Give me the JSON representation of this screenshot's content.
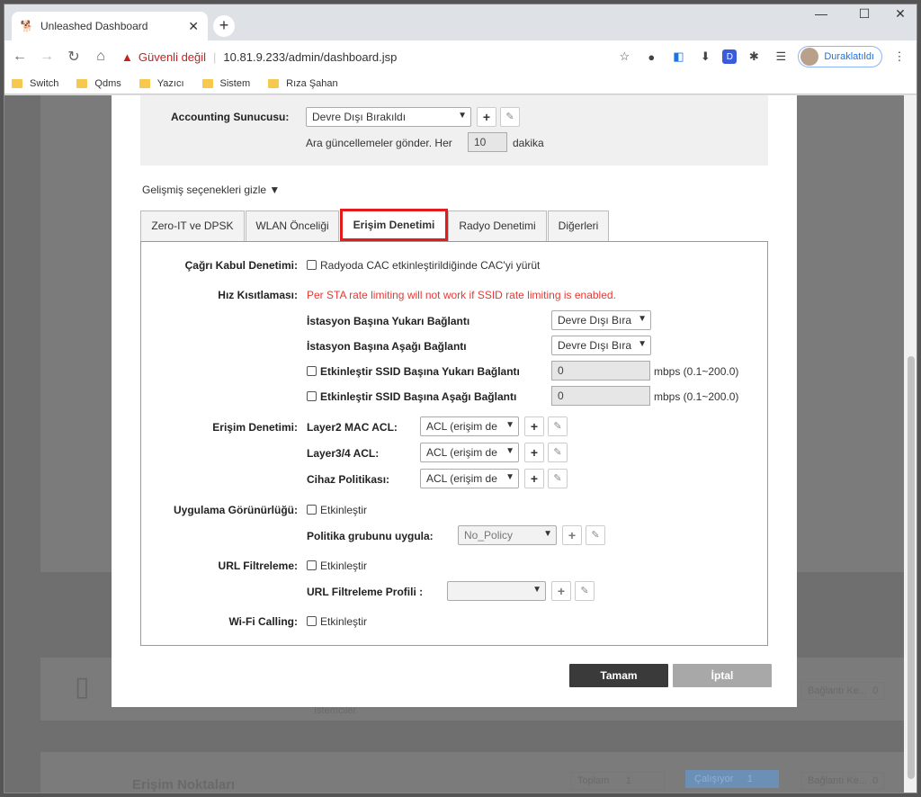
{
  "browser": {
    "tab_title": "Unleashed Dashboard",
    "insecure_label": "Güvenli değil",
    "url": "10.81.9.233/admin/dashboard.jsp",
    "profile_label": "Duraklatıldı",
    "bookmarks": [
      "Switch",
      "Qdms",
      "Yazıcı",
      "Sistem",
      "Rıza Şahan"
    ]
  },
  "background": {
    "clients_label": "İstemciler",
    "access_points_label": "Erişim Noktaları",
    "total_label": "Toplam",
    "total_value": "1",
    "running_label": "Çalışıyor",
    "running_value": "1",
    "disconnected_label": "Bağlantı Ke...",
    "disconnected_value": "0"
  },
  "dialog": {
    "accounting": {
      "label": "Accounting Sunucusu:",
      "value": "Devre Dışı Bırakıldı",
      "interim_prefix": "Ara güncellemeler gönder. Her",
      "interim_value": "10",
      "interim_suffix": "dakika"
    },
    "advanced_toggle": "Gelişmiş seçenekleri gizle ▼",
    "tabs": [
      "Zero-IT ve DPSK",
      "WLAN Önceliği",
      "Erişim Denetimi",
      "Radyo Denetimi",
      "Diğerleri"
    ],
    "active_tab": "Erişim Denetimi",
    "cac": {
      "label": "Çağrı Kabul Denetimi:",
      "checkbox_label": "Radyoda CAC etkinleştirildiğinde CAC'yi yürüt"
    },
    "rate": {
      "label": "Hız Kısıtlaması:",
      "warning": "Per STA rate limiting will not work if SSID rate limiting is enabled.",
      "uplink_label": "İstasyon Başına Yukarı Bağlantı",
      "uplink_value": "Devre Dışı Bıra",
      "downlink_label": "İstasyon Başına Aşağı Bağlantı",
      "downlink_value": "Devre Dışı Bıra",
      "ssid_up_label": "Etkinleştir SSID Başına Yukarı Bağlantı",
      "ssid_up_value": "0",
      "ssid_down_label": "Etkinleştir SSID Başına Aşağı Bağlantı",
      "ssid_down_value": "0",
      "mbps_hint": "mbps (0.1~200.0)"
    },
    "acl": {
      "label": "Erişim Denetimi:",
      "l2_label": "Layer2 MAC ACL:",
      "l2_value": "ACL (erişim de",
      "l34_label": "Layer3/4 ACL:",
      "l34_value": "ACL (erişim de",
      "device_label": "Cihaz Politikası:",
      "device_value": "ACL (erişim de"
    },
    "app": {
      "label": "Uygulama Görünürlüğü:",
      "checkbox_label": "Etkinleştir",
      "policy_label": "Politika grubunu uygula:",
      "policy_value": "No_Policy"
    },
    "url": {
      "label": "URL Filtreleme:",
      "checkbox_label": "Etkinleştir",
      "profile_label": "URL Filtreleme Profili :",
      "profile_value": ""
    },
    "wifi_calling": {
      "label": "Wi-Fi Calling:",
      "checkbox_label": "Etkinleştir"
    },
    "ok_label": "Tamam",
    "cancel_label": "İptal"
  }
}
